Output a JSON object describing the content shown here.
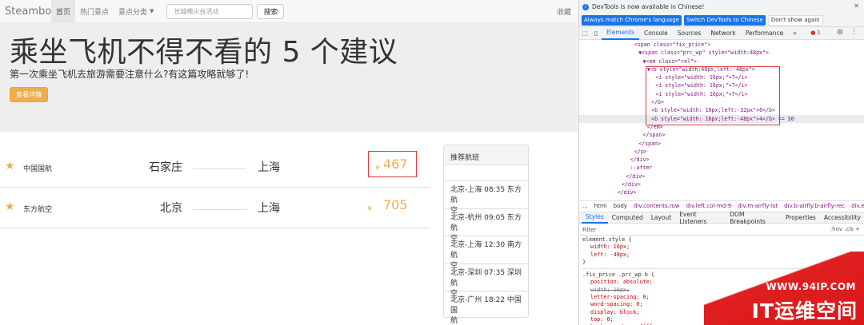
{
  "navbar": {
    "brand": "Steamboat",
    "items": [
      {
        "label": "首页",
        "active": true
      },
      {
        "label": "热门景点",
        "active": false
      },
      {
        "label": "景点分类",
        "active": false,
        "dropdown": true
      }
    ],
    "search_placeholder": "长城噜火台活动",
    "search_button": "搜索",
    "favorites": "收藏"
  },
  "hero": {
    "title": "乘坐飞机不得不看的 5 个建议",
    "subtitle": "第一次乘坐飞机去旅游需要注意什么?有这篇攻略就够了!",
    "button": "查看详情"
  },
  "flights": [
    {
      "airline": "中国国航",
      "from": "石家庄",
      "to": "上海",
      "currency": "¥",
      "price": "467"
    },
    {
      "airline": "东方航空",
      "from": "北京",
      "to": "上海",
      "currency": "¥",
      "price": "705"
    }
  ],
  "recommend": {
    "heading": "推荐航班",
    "items": [
      {
        "line1": "北京-上海 08:35 东方航",
        "line2": "空"
      },
      {
        "line1": "北京-杭州 09:05 东方航",
        "line2": "空"
      },
      {
        "line1": "北京-上海 12:30 南方航",
        "line2": "空"
      },
      {
        "line1": "北京-深圳 07:35 深圳航",
        "line2": "空"
      },
      {
        "line1": "北京-广州 18:22 中国国",
        "line2": "航"
      }
    ]
  },
  "devtools": {
    "info": "DevTools is now available in Chinese!",
    "btn_match": "Always match Chrome's language",
    "btn_switch": "Switch DevTools to Chinese",
    "btn_dont": "Don't show again",
    "tabs": [
      "Elements",
      "Console",
      "Sources",
      "Network",
      "Performance"
    ],
    "more_tabs": "»",
    "errors": "1",
    "dom_lines": [
      {
        "indent": 13,
        "text": "<span class=\"fix_price\">",
        "sel": false
      },
      {
        "indent": 14,
        "text": "▼<span class=\"prc_wp\" style=\"width:48px\">",
        "sel": false
      },
      {
        "indent": 15,
        "text": "▼<em class=\"rel\">",
        "sel": false
      },
      {
        "indent": 16,
        "text": "▼<b style=\"width:48px;left:-48px\">",
        "sel": false
      },
      {
        "indent": 18,
        "text": "<i style=\"width: 16px;\">7</i>",
        "sel": false
      },
      {
        "indent": 18,
        "text": "<i style=\"width: 16px;\">7</i>",
        "sel": false
      },
      {
        "indent": 18,
        "text": "<i style=\"width: 16px;\">7</i>",
        "sel": false
      },
      {
        "indent": 17,
        "text": "</b>",
        "sel": false
      },
      {
        "indent": 17,
        "text": "<b style=\"width: 16px;left:-32px\">6</b>",
        "sel": false
      },
      {
        "indent": 17,
        "text": "<b style=\"width: 16px;left:-48px\">4</b> == $0",
        "sel": true
      },
      {
        "indent": 16,
        "text": "</em>",
        "sel": false
      },
      {
        "indent": 15,
        "text": "</span>",
        "sel": false
      },
      {
        "indent": 14,
        "text": "</span>",
        "sel": false
      },
      {
        "indent": 13,
        "text": "</p>",
        "sel": false
      },
      {
        "indent": 12,
        "text": "</div>",
        "sel": false
      },
      {
        "indent": 12,
        "text": "::after",
        "sel": false
      },
      {
        "indent": 11,
        "text": "</div>",
        "sel": false
      },
      {
        "indent": 10,
        "text": "</div>",
        "sel": false
      },
      {
        "indent": 9,
        "text": "</div>",
        "sel": false
      }
    ],
    "crumbs": [
      "...",
      "html",
      "body",
      "div.contents.row",
      "div.left.col-md-9",
      "div.m-airfly-lst",
      "div.b-airfly.b-airfly-rec",
      "div.e-a"
    ],
    "subtabs": [
      "Styles",
      "Computed",
      "Layout",
      "Event Listeners",
      "DOM Breakpoints",
      "Properties",
      "Accessibility"
    ],
    "filter_placeholder": "Filter",
    "filter_right": ":hov  .cls  +",
    "styles": [
      {
        "kind": "sel",
        "text": "element.style {"
      },
      {
        "kind": "prop",
        "text": "width: 16px;"
      },
      {
        "kind": "prop",
        "text": "left: -48px;"
      },
      {
        "kind": "sel",
        "text": "}"
      },
      {
        "kind": "sep",
        "text": ""
      },
      {
        "kind": "sel",
        "text": ".fix_price .prc_wp b {"
      },
      {
        "kind": "prop",
        "text": "position: absolute;"
      },
      {
        "kind": "strike",
        "text": "width: 16px;"
      },
      {
        "kind": "prop",
        "text": "letter-spacing: 0;"
      },
      {
        "kind": "prop",
        "text": "word-spacing: 0;"
      },
      {
        "kind": "prop",
        "text": "display: block;"
      },
      {
        "kind": "prop",
        "text": "top: 0;"
      },
      {
        "kind": "prop",
        "text": "background: ▸ □#fff;"
      }
    ]
  },
  "watermark": {
    "url": "WWW.94IP.COM",
    "title": "IT运维空间"
  }
}
